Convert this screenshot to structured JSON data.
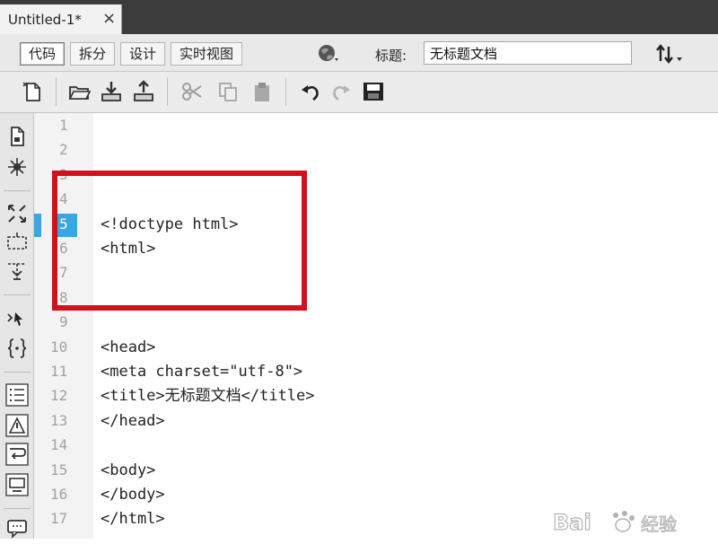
{
  "tab": {
    "title": "Untitled-1*",
    "close_glyph": "×"
  },
  "view": {
    "buttons": [
      "代码",
      "拆分",
      "设计",
      "实时视图"
    ],
    "active_index": 0,
    "title_label": "标题:",
    "title_value": "无标题文档"
  },
  "toolbar": {
    "icons": [
      "new-document-icon",
      "open-folder-icon",
      "get-file-icon",
      "put-file-icon",
      "cut-icon",
      "copy-icon",
      "paste-icon",
      "undo-icon",
      "redo-icon",
      "save-icon"
    ]
  },
  "sidebar": {
    "icons": [
      "document-icon",
      "snippet-icon",
      "expand-icon",
      "select-block-icon",
      "collapse-icon",
      "select-parent-icon",
      "balance-braces-icon",
      "line-numbers-icon",
      "highlight-invalid-icon",
      "word-wrap-icon",
      "syntax-color-icon",
      "comment-icon"
    ]
  },
  "editor": {
    "line_numbers": [
      "1",
      "2",
      "3",
      "4",
      "5",
      "6",
      "7",
      "8",
      "9",
      "10",
      "11",
      "12",
      "13",
      "14",
      "15",
      "16",
      "17"
    ],
    "current_line": "5",
    "lines": [
      {
        "n": "5",
        "text": "<!doctype html>"
      },
      {
        "n": "6",
        "text": "<html>"
      },
      {
        "n": "10",
        "text": "<head>"
      },
      {
        "n": "11",
        "text": "<meta charset=\"utf-8\">"
      },
      {
        "n": "12",
        "text": "<title>无标题文档</title>"
      },
      {
        "n": "13",
        "text": "</head>"
      },
      {
        "n": "15",
        "text": "<body>"
      },
      {
        "n": "16",
        "text": "</body>"
      },
      {
        "n": "17",
        "text": "</html>"
      }
    ],
    "highlight_color": "#d0121b",
    "current_line_color": "#3aa7e0"
  },
  "watermark": {
    "brand": "Bai",
    "suffix": "经验"
  }
}
